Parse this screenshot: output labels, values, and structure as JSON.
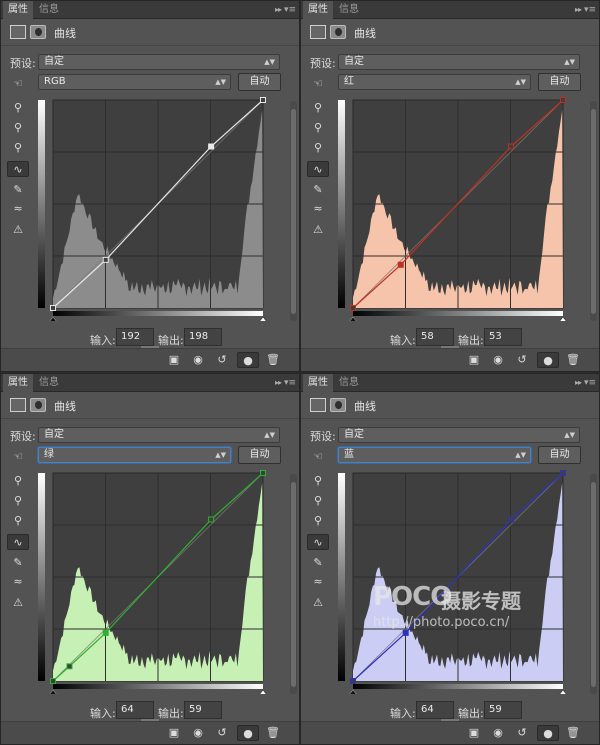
{
  "tabs": [
    "属性",
    "信息"
  ],
  "title": "曲线",
  "preset_label": "预设:",
  "preset_value": "自定",
  "auto_label": "自动",
  "input_label": "输入:",
  "output_label": "输出:",
  "footer_icons": [
    "clip-to-layer-icon",
    "view-previous-icon",
    "reset-icon",
    "visibility-eye-icon",
    "trash-icon"
  ],
  "tool_icons": [
    "finger-adjust-icon",
    "black-point-eyedropper-icon",
    "gray-point-eyedropper-icon",
    "white-point-eyedropper-icon",
    "curve-points-icon",
    "pencil-draw-icon",
    "smooth-curve-icon",
    "clipping-warning-icon"
  ],
  "panels": [
    {
      "channel": "RGB",
      "input": "192",
      "output": "198",
      "fill": "#8c8c8c",
      "line": "#e8e8e8",
      "curve_points": [
        [
          0,
          0
        ],
        [
          64,
          59
        ],
        [
          192,
          198
        ],
        [
          255,
          255
        ]
      ],
      "selected_point": 2
    },
    {
      "channel": "红",
      "input": "58",
      "output": "53",
      "fill": "#f6c4aa",
      "line": "#c03020",
      "curve_points": [
        [
          0,
          0
        ],
        [
          58,
          53
        ],
        [
          192,
          198
        ],
        [
          255,
          255
        ]
      ],
      "selected_point": 1
    },
    {
      "channel": "绿",
      "input": "64",
      "output": "59",
      "fill": "#c6f0b4",
      "line": "#30b030",
      "curve_points": [
        [
          0,
          0
        ],
        [
          20,
          18
        ],
        [
          64,
          59
        ],
        [
          192,
          198
        ],
        [
          255,
          255
        ]
      ],
      "selected_point": 2
    },
    {
      "channel": "蓝",
      "input": "64",
      "output": "59",
      "fill": "#cccdf4",
      "line": "#3030c0",
      "curve_points": [
        [
          0,
          0
        ],
        [
          64,
          59
        ],
        [
          192,
          198
        ],
        [
          255,
          255
        ]
      ],
      "selected_point": 1
    }
  ],
  "watermark": {
    "brand": "POCO",
    "cn": "摄影专题",
    "url": "http://photo.poco.cn/"
  }
}
